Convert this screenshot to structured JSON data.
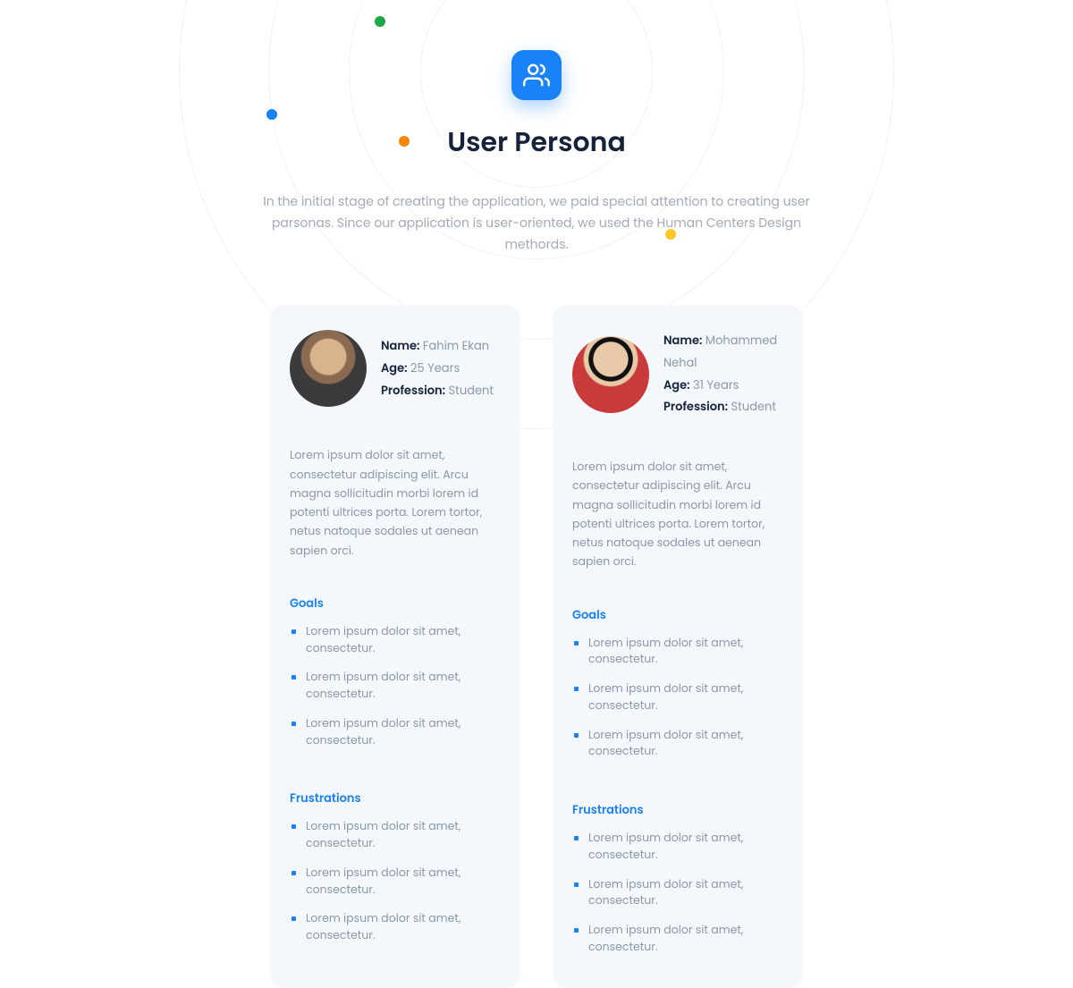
{
  "header": {
    "title": "User Persona",
    "subtitle": "In the initial stage of creating the application, we paid special attention to creating user parsonas. Since our application is user-oriented, we used the Human Centers Design methords."
  },
  "labels": {
    "name": "Name:",
    "age": "Age:",
    "profession": "Profession:",
    "goals": "Goals",
    "frustrations": "Frustrations"
  },
  "personas": [
    {
      "name": "Fahim Ekan",
      "age": "25 Years",
      "profession": "Student",
      "bio": "Lorem ipsum dolor sit amet, consectetur adipiscing elit. Arcu magna sollicitudin morbi lorem id potenti ultrices porta. Lorem tortor, netus natoque sodales ut aenean sapien orci.",
      "goals": [
        "Lorem ipsum dolor sit amet, consectetur.",
        "Lorem ipsum dolor sit amet, consectetur.",
        "Lorem ipsum dolor sit amet, consectetur."
      ],
      "frustrations": [
        "Lorem ipsum dolor sit amet, consectetur.",
        "Lorem ipsum dolor sit amet, consectetur.",
        "Lorem ipsum dolor sit amet, consectetur."
      ]
    },
    {
      "name": "Mohammed Nehal",
      "age": "31 Years",
      "profession": "Student",
      "bio": "Lorem ipsum dolor sit amet, consectetur adipiscing elit. Arcu magna sollicitudin morbi lorem id potenti ultrices porta. Lorem tortor, netus natoque sodales ut aenean sapien orci.",
      "goals": [
        "Lorem ipsum dolor sit amet, consectetur.",
        "Lorem ipsum dolor sit amet, consectetur.",
        "Lorem ipsum dolor sit amet, consectetur."
      ],
      "frustrations": [
        "Lorem ipsum dolor sit amet, consectetur.",
        "Lorem ipsum dolor sit amet, consectetur.",
        "Lorem ipsum dolor sit amet, consectetur."
      ]
    }
  ],
  "colors": {
    "accent": "#1a82f7",
    "green_dot": "#1fa846",
    "blue_dot": "#1a82f7",
    "orange_dot": "#f2880c",
    "yellow_dot": "#fdc724"
  }
}
